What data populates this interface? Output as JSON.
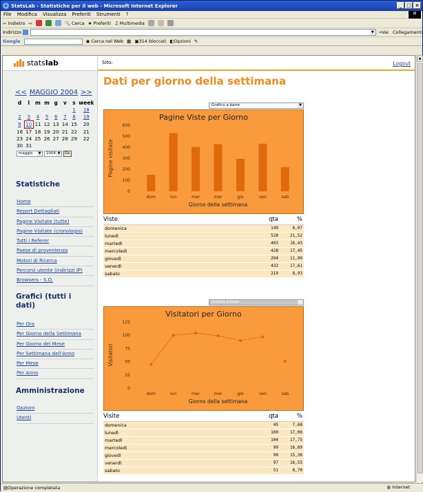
{
  "window": {
    "title": "StatsLab - Statistiche per il web - Microsoft Internet Explorer"
  },
  "menubar": [
    "File",
    "Modifica",
    "Visualizza",
    "Preferiti",
    "Strumenti",
    "?"
  ],
  "toolbar": {
    "back": "Indietro",
    "search": "Cerca",
    "favorites": "Preferiti",
    "multimedia": "Multimedia"
  },
  "address": {
    "label": "Indirizzo",
    "go": "Vai",
    "links": "Collegamenti"
  },
  "googlebar": {
    "logo": "Google",
    "search_web": "Cerca nel Web",
    "blocked": "314 bloccati",
    "options": "Opzioni"
  },
  "status": {
    "text": "Operazione completata",
    "zone": "Internet"
  },
  "sidebar": {
    "logo_light": "stats",
    "logo_bold": "lab",
    "calendar": {
      "prev": "<<",
      "month": "MAGGIO 2004",
      "next": ">>",
      "days": [
        "d",
        "l",
        "m",
        "m",
        "g",
        "v",
        "s",
        "week"
      ],
      "rows": [
        [
          "",
          "",
          "",
          "",
          "",
          "",
          "1",
          "18"
        ],
        [
          "2",
          "3",
          "4",
          "5",
          "6",
          "7",
          "8",
          "19"
        ],
        [
          "9",
          "10",
          "11",
          "12",
          "13",
          "14",
          "15",
          "20"
        ],
        [
          "16",
          "17",
          "18",
          "19",
          "20",
          "21",
          "22",
          "21"
        ],
        [
          "23",
          "24",
          "25",
          "26",
          "27",
          "28",
          "29",
          "22"
        ],
        [
          "30",
          "31",
          "",
          "",
          "",
          "",
          "",
          ""
        ]
      ],
      "month_select": "maggio",
      "year_select": "2004",
      "go": "Go"
    },
    "sections": {
      "stats_title": "Statistiche",
      "stats_links": [
        "Home",
        "Report Dettagliati",
        "Pagine Visitate (tutte)",
        "Pagine Visitate (cronologia)",
        "Tutti i Referer",
        "Paese di provenienza",
        "Motori di Ricerca",
        "Percorsi utente (indirizzi IP)",
        "Browsers - S.O."
      ],
      "graphs_title_1": "Grafici (tutti i",
      "graphs_title_2": "dati)",
      "graphs_links": [
        "Per Ora",
        "Per Giorno della Settimana",
        "Per Giorno del Mese",
        "Per Settimana dell'Anno",
        "Per Mese",
        "Per Anno"
      ],
      "admin_title": "Amministrazione",
      "admin_links": [
        "Opzioni",
        "Utenti"
      ]
    }
  },
  "main": {
    "site_label": "Sito:",
    "logout": "Logout",
    "title": "Dati per giorno della settimana",
    "chart_type_1": "Grafico a barre",
    "chart_type_2": "Grafico a linee",
    "table1": {
      "headers": [
        "Viste",
        "qta",
        "%"
      ],
      "rows": [
        [
          "domenica",
          "149",
          "6,07"
        ],
        [
          "lunedì",
          "528",
          "21,52"
        ],
        [
          "martedì",
          "403",
          "16,43"
        ],
        [
          "mercoledì",
          "428",
          "17,45"
        ],
        [
          "giovedì",
          "294",
          "11,99"
        ],
        [
          "venerdì",
          "432",
          "17,61"
        ],
        [
          "sabato",
          "219",
          "8,93"
        ]
      ]
    },
    "table2": {
      "headers": [
        "Visite",
        "qta",
        "%"
      ],
      "rows": [
        [
          "domenica",
          "45",
          "7,68"
        ],
        [
          "lunedì",
          "100",
          "17,06"
        ],
        [
          "martedì",
          "104",
          "17,75"
        ],
        [
          "mercoledì",
          "99",
          "16,89"
        ],
        [
          "giovedì",
          "90",
          "15,36"
        ],
        [
          "venerdì",
          "97",
          "16,55"
        ],
        [
          "sabato",
          "51",
          "8,70"
        ]
      ]
    }
  },
  "chart_data": [
    {
      "type": "bar",
      "title": "Pagine Viste per Giorno",
      "xlabel": "Giorno della settimana",
      "ylabel": "Pagine visitate",
      "categories": [
        "dom",
        "lun",
        "mar",
        "mer",
        "gio",
        "ven",
        "sab"
      ],
      "values": [
        149,
        528,
        403,
        428,
        294,
        432,
        219
      ],
      "yticks": [
        0,
        100,
        200,
        300,
        400,
        500,
        600
      ],
      "ylim": [
        0,
        600
      ],
      "bar_color": "#e06a0a",
      "bg_color": "#f99a3c"
    },
    {
      "type": "line",
      "title": "Visitatori per Giorno",
      "xlabel": "Giorno della settimana",
      "ylabel": "Visitatori",
      "categories": [
        "dom",
        "lun",
        "mar",
        "mer",
        "gio",
        "ven",
        "sab"
      ],
      "values": [
        45,
        100,
        104,
        99,
        90,
        97,
        51
      ],
      "yticks": [
        0,
        25,
        50,
        75,
        100,
        125
      ],
      "ylim": [
        0,
        125
      ],
      "line_color": "#e06a0a",
      "bg_color": "#f99a3c"
    }
  ]
}
